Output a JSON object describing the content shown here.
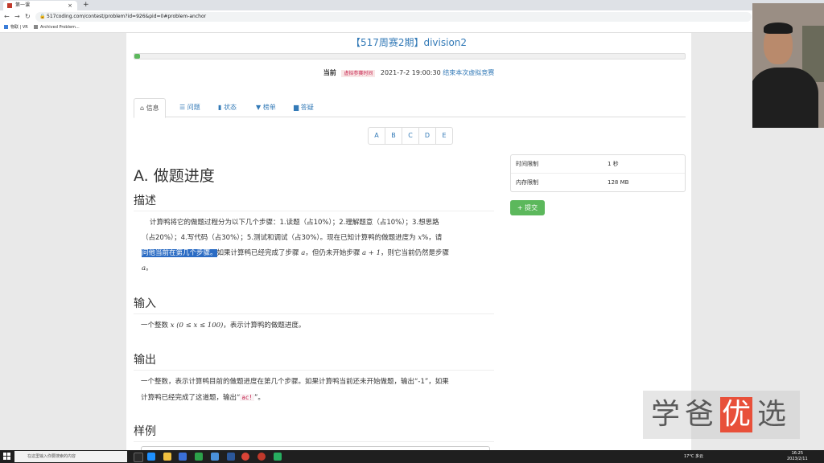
{
  "browser": {
    "tab_title": "第一课",
    "tab_close": "×",
    "new_tab": "+",
    "url": "517coding.com/contest/problem?id=926&pid=0#problem-anchor",
    "bookmarks": [
      "物联 | VR",
      "Archived Problem..."
    ]
  },
  "contest": {
    "title": "【517周赛2期】division2",
    "progress_percent": 1,
    "status_label": "当前",
    "status_badge": "虚拟参赛时间",
    "time": "2021-7-2 19:00:30",
    "end_link": "结束本次虚拟竞赛"
  },
  "tabs": [
    {
      "icon": "⌂",
      "label": "信息"
    },
    {
      "icon": "☰",
      "label": "问题"
    },
    {
      "icon": "▮",
      "label": "状态"
    },
    {
      "icon": "▼",
      "label": "榜单"
    },
    {
      "icon": "▆",
      "label": "答疑"
    }
  ],
  "pager": [
    "A",
    "B",
    "C",
    "D",
    "E"
  ],
  "problem": {
    "title": "A. 做题进度",
    "desc_heading": "描述",
    "desc_l1": "计算鸭将它的做题过程分为以下几个步骤：1.读题（占10%）；2.理解题意（占10%）；3.想思路",
    "desc_l2a": "（占20%）；4.写代码（占30%）；5.测试和调试（占30%）。现在已知计算鸭的做题进度为",
    "desc_var_x": "x",
    "desc_l2b": "%，请",
    "desc_hl": "问他当前在第几个步骤。",
    "desc_l3a": "如果计算鸭已经完成了步骤",
    "desc_var_a": "a",
    "desc_l3b": "，但仍未开始步骤",
    "desc_expr": "a + 1",
    "desc_l3c": "，则它当前仍然是步骤",
    "desc_l4": "a",
    "desc_l4b": "。",
    "input_heading": "输入",
    "input_a": "一个整数",
    "input_math": "x (0 ≤ x ≤ 100)",
    "input_b": "，表示计算鸭的做题进度。",
    "output_heading": "输出",
    "output_l1": "一个整数，表示计算鸭目前的做题进度在第几个步骤。如果计算鸭当前还未开始做题，输出“-1”，如果",
    "output_l2a": "计算鸭已经完成了这道题，输出“",
    "output_code": "ac!",
    "output_l2b": "”。",
    "sample_heading": "样例"
  },
  "limits": [
    {
      "key": "时间限制",
      "value": "1 秒"
    },
    {
      "key": "内存限制",
      "value": "128 MB"
    }
  ],
  "submit_label": "提交",
  "submit_icon": "plus-icon",
  "watermark": {
    "w1": "学",
    "w2": "爸",
    "w3": "优",
    "w4": "选"
  },
  "taskbar": {
    "search_placeholder": "在这里输入你要搜索的内容",
    "weather": "17°C 多云",
    "time": "16:25",
    "date": "2023/2/11"
  }
}
